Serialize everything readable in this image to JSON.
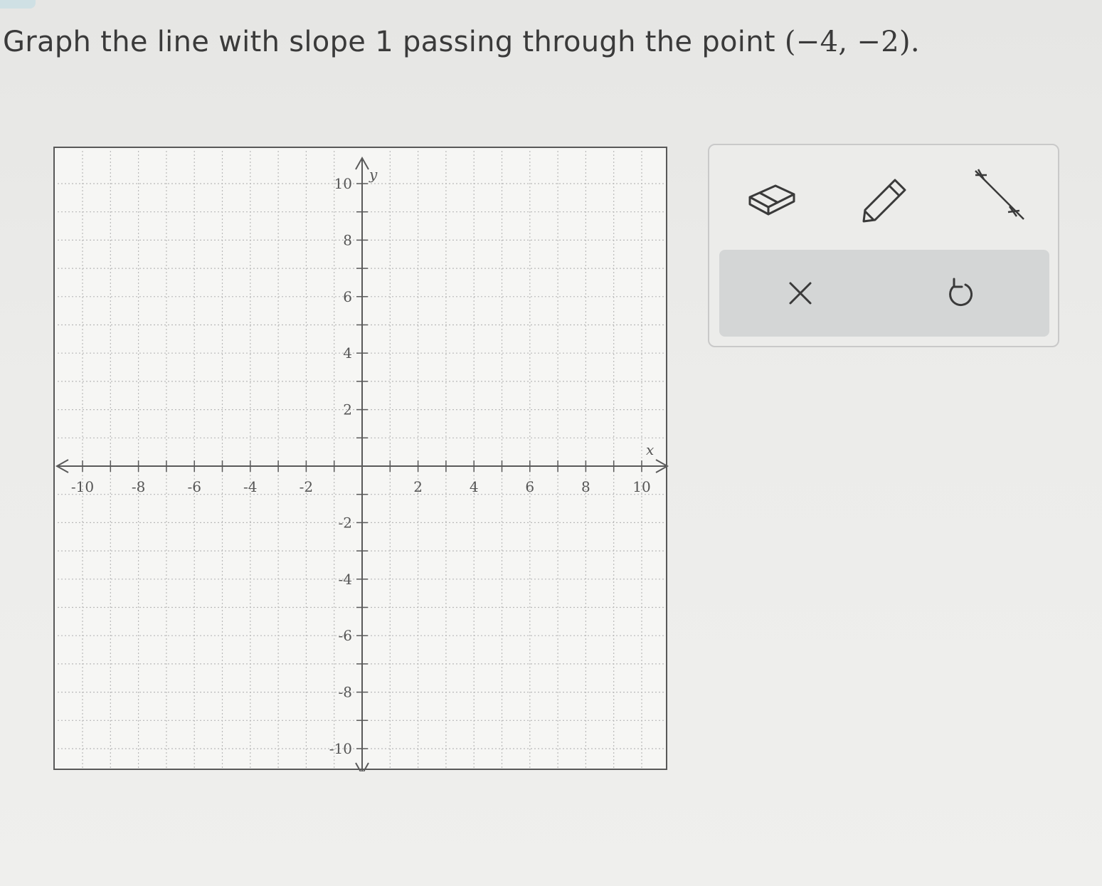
{
  "prompt": {
    "text": "Graph the line with slope 1 passing through the point ",
    "point": "(−4, −2)."
  },
  "graph": {
    "x_axis_label": "x",
    "y_axis_label": "y",
    "x_range": [
      -10,
      10
    ],
    "y_range": [
      -10,
      10
    ],
    "grid_step": 1,
    "x_ticks": [
      -10,
      -8,
      -6,
      -4,
      -2,
      2,
      4,
      6,
      8,
      10
    ],
    "y_ticks": [
      10,
      8,
      6,
      4,
      2,
      -2,
      -4,
      -6,
      -8,
      -10
    ]
  },
  "toolbar": {
    "tools": [
      {
        "name": "eraser-icon"
      },
      {
        "name": "pencil-icon"
      },
      {
        "name": "line-tool-icon"
      }
    ],
    "clear_icon": "close-icon",
    "undo_icon": "undo-icon",
    "icon_color": "#3a3a3a"
  }
}
